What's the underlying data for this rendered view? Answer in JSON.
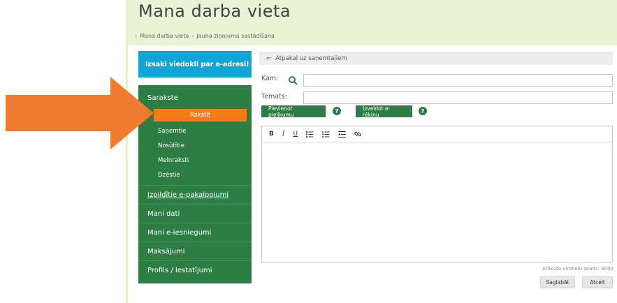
{
  "header": {
    "title": "Mana darba vieta",
    "breadcrumb": [
      "Mana darba vieta",
      "Jauna ziņojuma sastādīšana"
    ]
  },
  "feedback": {
    "label": "Izsaki viedokli par e-adresi!"
  },
  "sidebar": {
    "sections": [
      "Sarakste",
      "Izpildītie e-pakalpojumi",
      "Mani dati",
      "Mani e-iesniegumi",
      "Maksājumi",
      "Profils / Iestatījumi"
    ],
    "subitems": [
      "Rakstīt",
      "Saņemtie",
      "Nosūtītie",
      "Melnraksti",
      "Dzēstie"
    ]
  },
  "compose": {
    "back_label": "Atpakaļ uz saņemtajiem",
    "to_label": "Kam:",
    "subject_label": "Temats:",
    "attach_button": "Pievienot pielikumu",
    "invoice_button": "Izveidot e-rēķinu",
    "help_glyph": "?",
    "toolbar": {
      "bold": "B",
      "italic": "I",
      "underline": "U"
    },
    "char_counter": "Atlikušo simbolu skaits: 4000",
    "save_button": "Saglabāt",
    "cancel_button": "Atcelt"
  },
  "colors": {
    "sidebar_green": "#2e7d45",
    "active_orange": "#f57c14",
    "feedback_blue": "#13a5d6",
    "arrow_orange": "#ee7b30",
    "header_band": "#e9f3d6"
  },
  "icons": {
    "search": "search-icon",
    "back": "back-arrow-icon",
    "pointer": "arrow-pointer-icon"
  }
}
